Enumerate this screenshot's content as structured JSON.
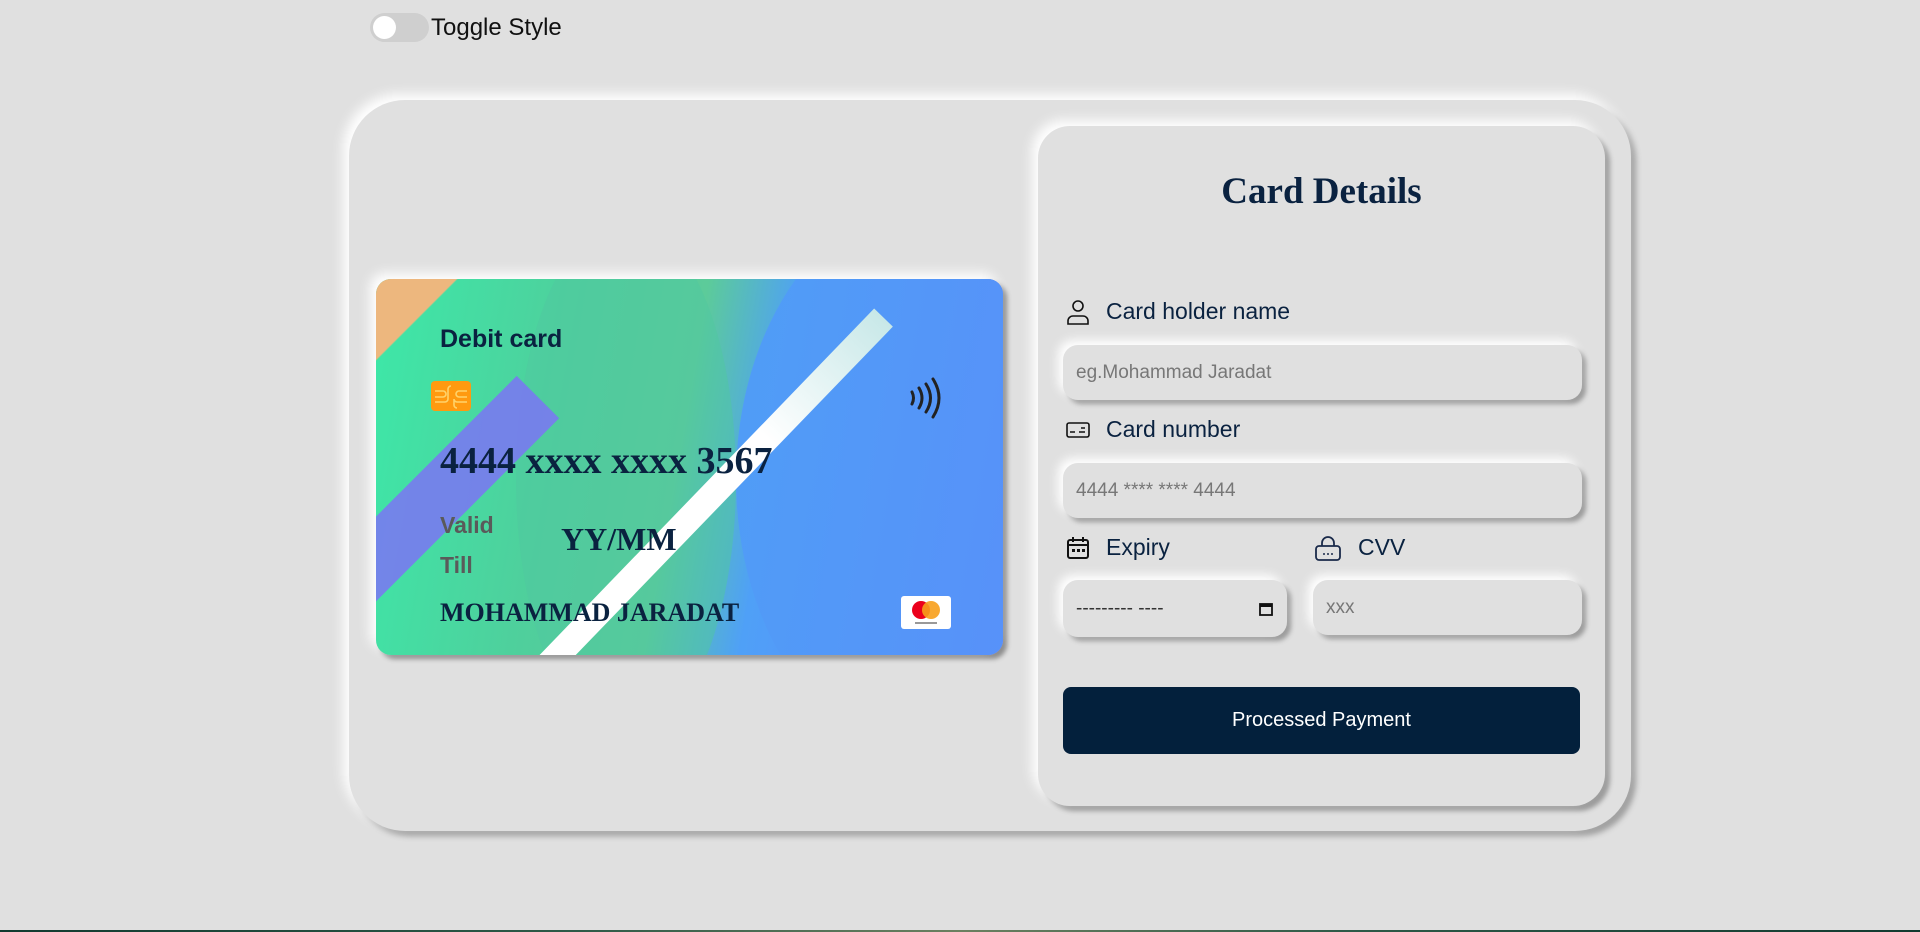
{
  "toggle": {
    "label": "Toggle Style",
    "on": false
  },
  "card": {
    "type_label": "Debit card",
    "number": "4444 xxxx xxxx 3567",
    "valid_label_1": "Valid",
    "valid_label_2": "Till",
    "expiry": "YY/MM",
    "holder": "MOHAMMAD JARADAT",
    "brand": "mastercard",
    "icons": [
      "chip-icon",
      "contactless-icon",
      "mastercard-logo"
    ]
  },
  "form": {
    "title": "Card Details",
    "holder_label": "Card holder name",
    "holder_placeholder": "eg.Mohammad Jaradat",
    "number_label": "Card number",
    "number_placeholder": "4444 **** **** 4444",
    "expiry_label": "Expiry",
    "expiry_placeholder": "--------- ----",
    "cvv_label": "CVV",
    "cvv_placeholder": "xxx",
    "submit_label": "Processed Payment",
    "icons": [
      "user-icon",
      "credit-card-icon",
      "calendar-icon",
      "lock-icon"
    ]
  },
  "colors": {
    "background": "#e0e0e0",
    "primary": "#03203c",
    "text": "#0a2240",
    "chip": "#ff9a10"
  }
}
